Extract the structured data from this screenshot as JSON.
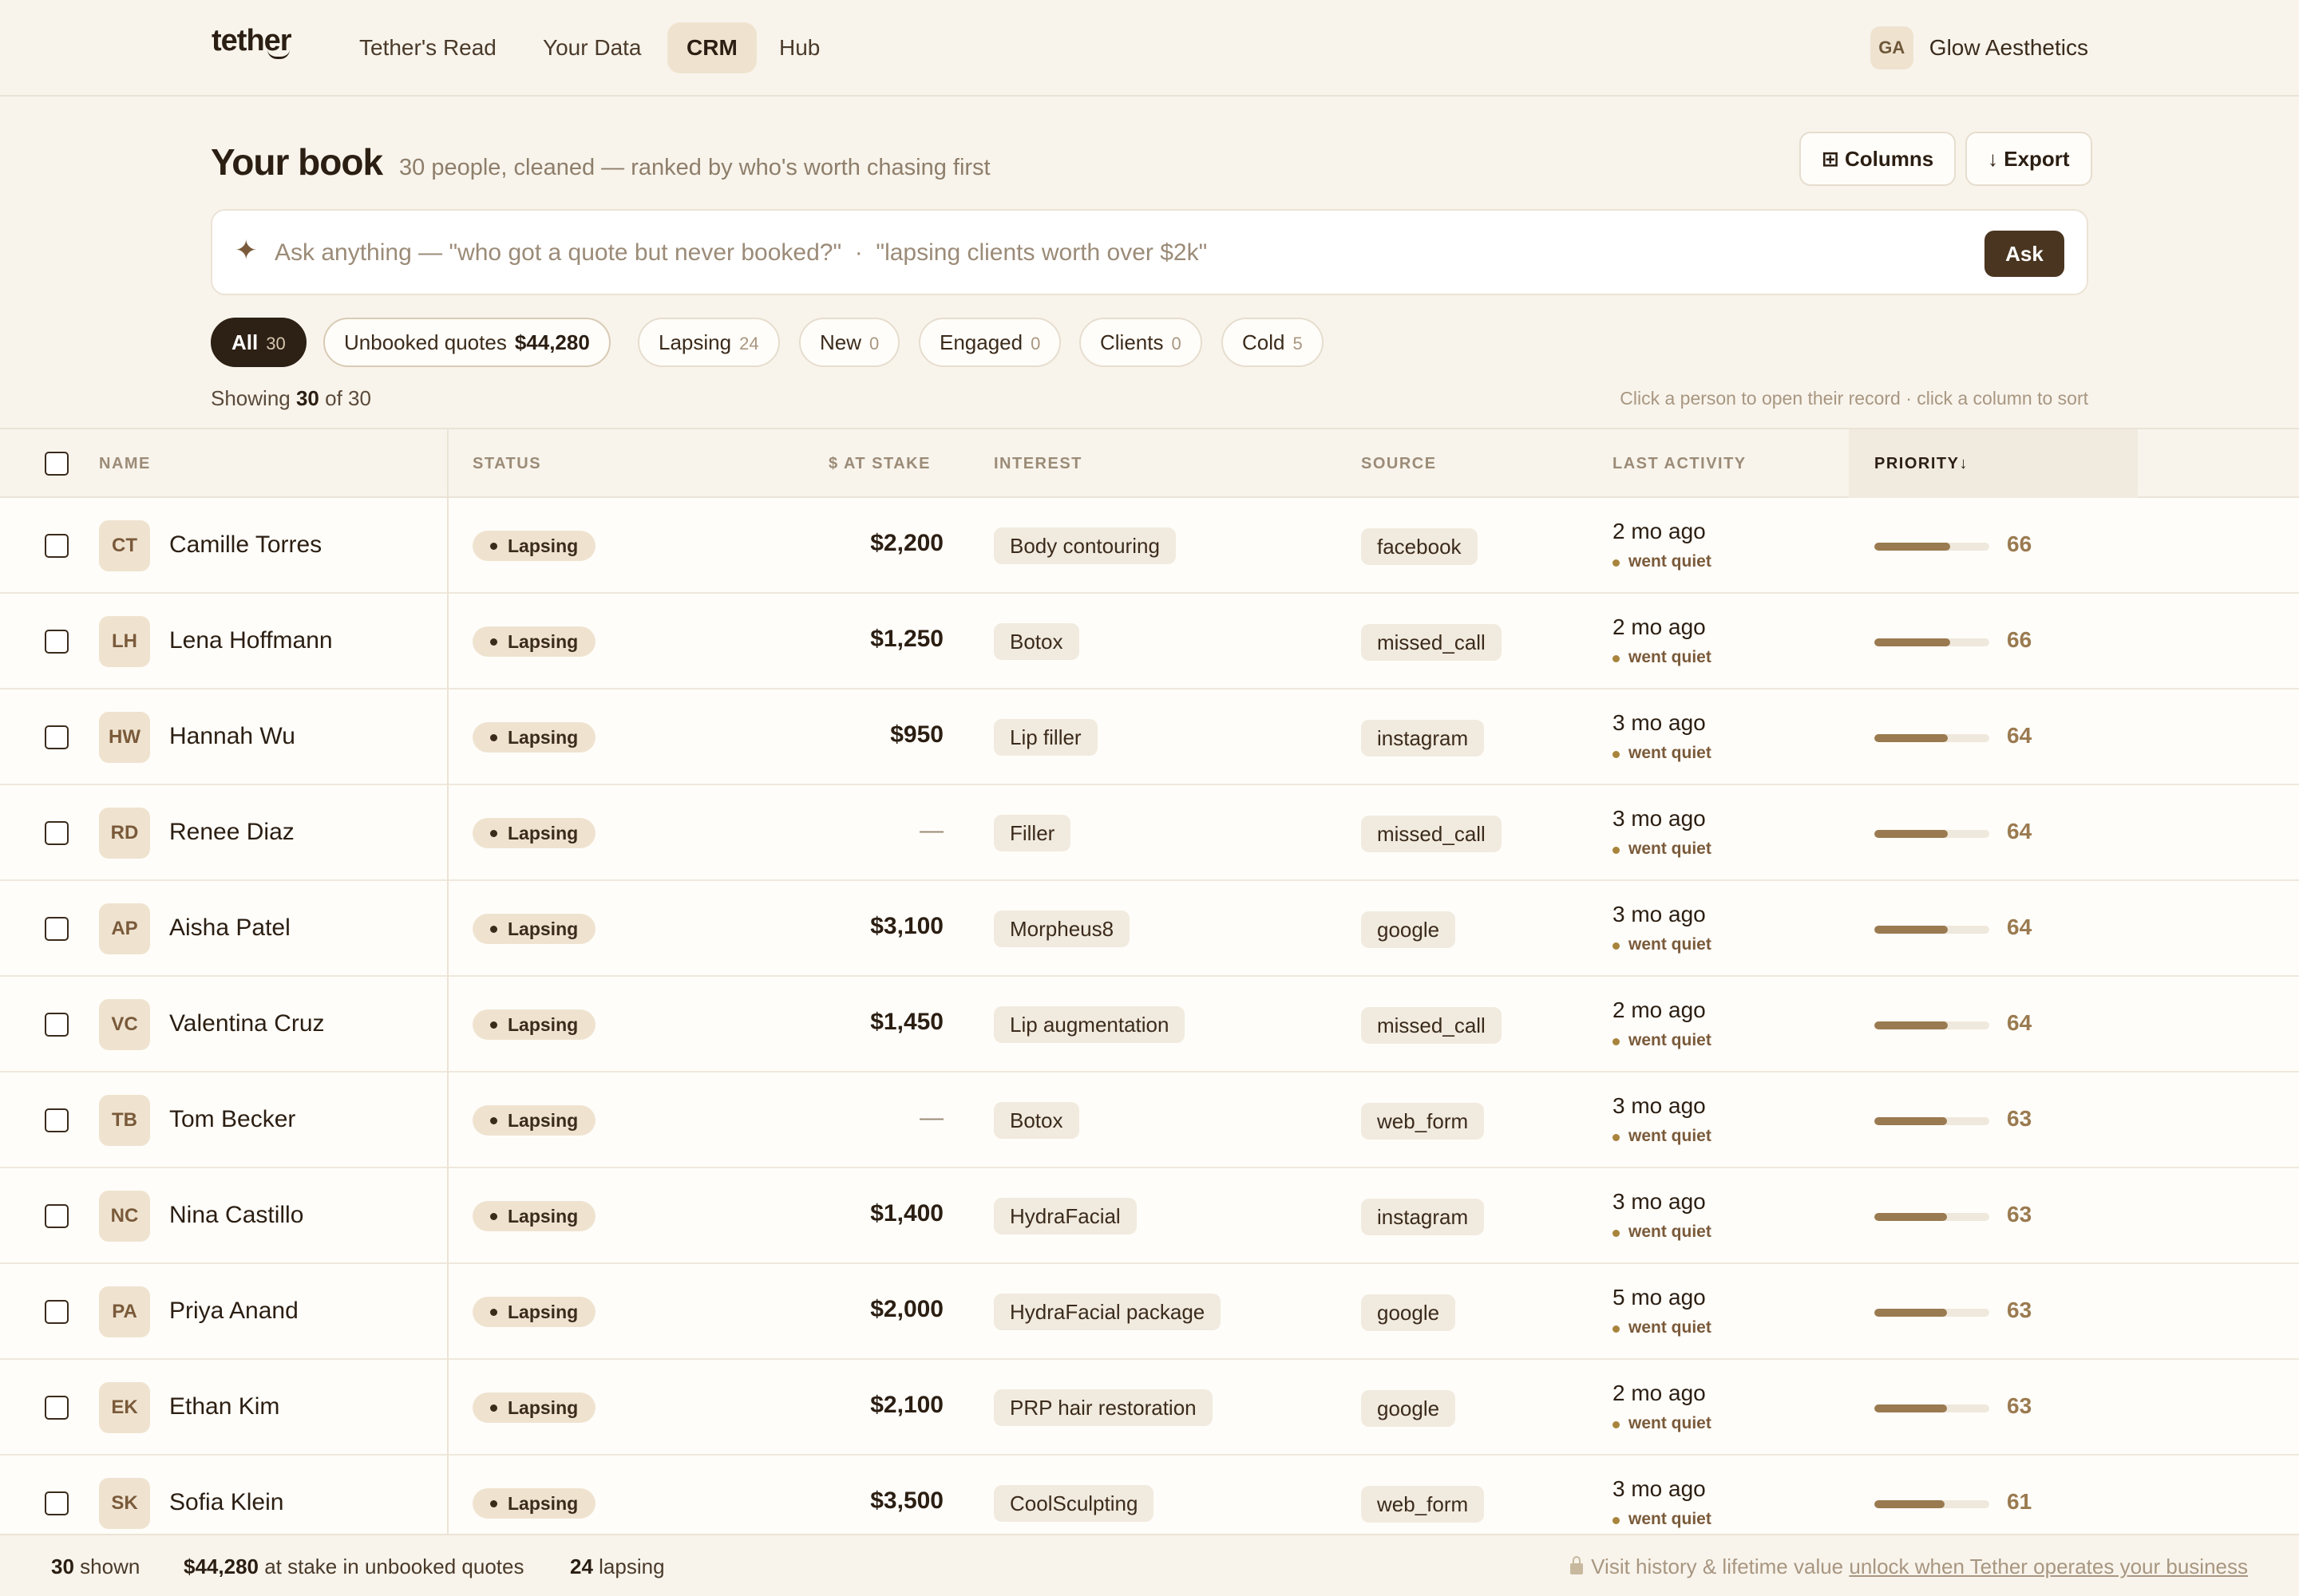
{
  "nav": {
    "logo": "tether",
    "tabs": [
      "Tether's Read",
      "Your Data",
      "CRM",
      "Hub"
    ],
    "active_tab": "CRM",
    "account_initials": "GA",
    "account_name": "Glow Aesthetics"
  },
  "header": {
    "title": "Your book",
    "subtitle": "30 people, cleaned — ranked by who's worth chasing first",
    "columns_label": "⊞ Columns",
    "export_label": "↓ Export"
  },
  "ask": {
    "placeholder": "Ask anything — \"who got a quote but never booked?\"  ·  \"lapsing clients worth over $2k\"",
    "button": "Ask",
    "icon": "sparkle-icon"
  },
  "filters": {
    "all": {
      "label": "All",
      "count": "30"
    },
    "quotes": {
      "label": "Unbooked quotes",
      "amount": "$44,280"
    },
    "lapsing": {
      "label": "Lapsing",
      "count": "24"
    },
    "new": {
      "label": "New",
      "count": "0"
    },
    "engaged": {
      "label": "Engaged",
      "count": "0"
    },
    "clients": {
      "label": "Clients",
      "count": "0"
    },
    "cold": {
      "label": "Cold",
      "count": "5"
    }
  },
  "showing": {
    "prefix": "Showing",
    "shown": "30",
    "of": "of 30"
  },
  "hint": "Click a person to open their record · click a column to sort",
  "columns": {
    "name": "NAME",
    "status": "STATUS",
    "stake": "$ AT STAKE",
    "interest": "INTEREST",
    "source": "SOURCE",
    "last_activity": "LAST ACTIVITY",
    "priority": "PRIORITY↓"
  },
  "rows": [
    {
      "initials": "CT",
      "name": "Camille Torres",
      "status": "Lapsing",
      "stake": "$2,200",
      "interest": "Body contouring",
      "source": "facebook",
      "last": "2 mo ago",
      "last_sub": "went quiet",
      "priority": 66
    },
    {
      "initials": "LH",
      "name": "Lena Hoffmann",
      "status": "Lapsing",
      "stake": "$1,250",
      "interest": "Botox",
      "source": "missed_call",
      "last": "2 mo ago",
      "last_sub": "went quiet",
      "priority": 66
    },
    {
      "initials": "HW",
      "name": "Hannah Wu",
      "status": "Lapsing",
      "stake": "$950",
      "interest": "Lip filler",
      "source": "instagram",
      "last": "3 mo ago",
      "last_sub": "went quiet",
      "priority": 64
    },
    {
      "initials": "RD",
      "name": "Renee Diaz",
      "status": "Lapsing",
      "stake": "—",
      "interest": "Filler",
      "source": "missed_call",
      "last": "3 mo ago",
      "last_sub": "went quiet",
      "priority": 64
    },
    {
      "initials": "AP",
      "name": "Aisha Patel",
      "status": "Lapsing",
      "stake": "$3,100",
      "interest": "Morpheus8",
      "source": "google",
      "last": "3 mo ago",
      "last_sub": "went quiet",
      "priority": 64
    },
    {
      "initials": "VC",
      "name": "Valentina Cruz",
      "status": "Lapsing",
      "stake": "$1,450",
      "interest": "Lip augmentation",
      "source": "missed_call",
      "last": "2 mo ago",
      "last_sub": "went quiet",
      "priority": 64
    },
    {
      "initials": "TB",
      "name": "Tom Becker",
      "status": "Lapsing",
      "stake": "—",
      "interest": "Botox",
      "source": "web_form",
      "last": "3 mo ago",
      "last_sub": "went quiet",
      "priority": 63
    },
    {
      "initials": "NC",
      "name": "Nina Castillo",
      "status": "Lapsing",
      "stake": "$1,400",
      "interest": "HydraFacial",
      "source": "instagram",
      "last": "3 mo ago",
      "last_sub": "went quiet",
      "priority": 63
    },
    {
      "initials": "PA",
      "name": "Priya Anand",
      "status": "Lapsing",
      "stake": "$2,000",
      "interest": "HydraFacial package",
      "source": "google",
      "last": "5 mo ago",
      "last_sub": "went quiet",
      "priority": 63
    },
    {
      "initials": "EK",
      "name": "Ethan Kim",
      "status": "Lapsing",
      "stake": "$2,100",
      "interest": "PRP hair restoration",
      "source": "google",
      "last": "2 mo ago",
      "last_sub": "went quiet",
      "priority": 63
    },
    {
      "initials": "SK",
      "name": "Sofia Klein",
      "status": "Lapsing",
      "stake": "$3,500",
      "interest": "CoolSculpting",
      "source": "web_form",
      "last": "3 mo ago",
      "last_sub": "went quiet",
      "priority": 61
    }
  ],
  "footer": {
    "shown_count": "30",
    "shown_label": "shown",
    "stake_amount": "$44,280",
    "stake_label": "at stake in unbooked quotes",
    "lapsing_count": "24",
    "lapsing_label": "lapsing",
    "note_prefix": "Visit history & lifetime value",
    "note_link": "unlock when Tether operates your business"
  }
}
